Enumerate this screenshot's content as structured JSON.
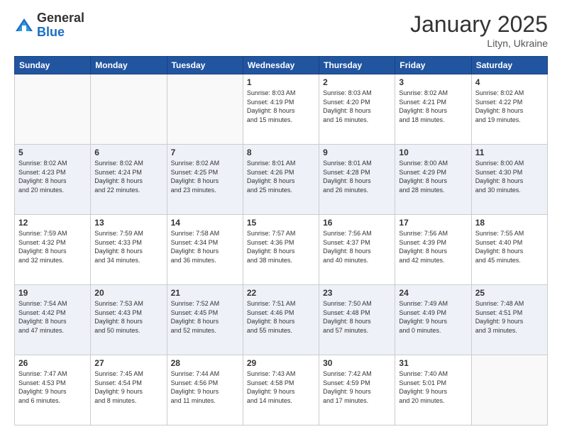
{
  "header": {
    "logo_general": "General",
    "logo_blue": "Blue",
    "month_title": "January 2025",
    "location": "Lityn, Ukraine"
  },
  "weekdays": [
    "Sunday",
    "Monday",
    "Tuesday",
    "Wednesday",
    "Thursday",
    "Friday",
    "Saturday"
  ],
  "weeks": [
    [
      {
        "day": "",
        "info": ""
      },
      {
        "day": "",
        "info": ""
      },
      {
        "day": "",
        "info": ""
      },
      {
        "day": "1",
        "info": "Sunrise: 8:03 AM\nSunset: 4:19 PM\nDaylight: 8 hours\nand 15 minutes."
      },
      {
        "day": "2",
        "info": "Sunrise: 8:03 AM\nSunset: 4:20 PM\nDaylight: 8 hours\nand 16 minutes."
      },
      {
        "day": "3",
        "info": "Sunrise: 8:02 AM\nSunset: 4:21 PM\nDaylight: 8 hours\nand 18 minutes."
      },
      {
        "day": "4",
        "info": "Sunrise: 8:02 AM\nSunset: 4:22 PM\nDaylight: 8 hours\nand 19 minutes."
      }
    ],
    [
      {
        "day": "5",
        "info": "Sunrise: 8:02 AM\nSunset: 4:23 PM\nDaylight: 8 hours\nand 20 minutes."
      },
      {
        "day": "6",
        "info": "Sunrise: 8:02 AM\nSunset: 4:24 PM\nDaylight: 8 hours\nand 22 minutes."
      },
      {
        "day": "7",
        "info": "Sunrise: 8:02 AM\nSunset: 4:25 PM\nDaylight: 8 hours\nand 23 minutes."
      },
      {
        "day": "8",
        "info": "Sunrise: 8:01 AM\nSunset: 4:26 PM\nDaylight: 8 hours\nand 25 minutes."
      },
      {
        "day": "9",
        "info": "Sunrise: 8:01 AM\nSunset: 4:28 PM\nDaylight: 8 hours\nand 26 minutes."
      },
      {
        "day": "10",
        "info": "Sunrise: 8:00 AM\nSunset: 4:29 PM\nDaylight: 8 hours\nand 28 minutes."
      },
      {
        "day": "11",
        "info": "Sunrise: 8:00 AM\nSunset: 4:30 PM\nDaylight: 8 hours\nand 30 minutes."
      }
    ],
    [
      {
        "day": "12",
        "info": "Sunrise: 7:59 AM\nSunset: 4:32 PM\nDaylight: 8 hours\nand 32 minutes."
      },
      {
        "day": "13",
        "info": "Sunrise: 7:59 AM\nSunset: 4:33 PM\nDaylight: 8 hours\nand 34 minutes."
      },
      {
        "day": "14",
        "info": "Sunrise: 7:58 AM\nSunset: 4:34 PM\nDaylight: 8 hours\nand 36 minutes."
      },
      {
        "day": "15",
        "info": "Sunrise: 7:57 AM\nSunset: 4:36 PM\nDaylight: 8 hours\nand 38 minutes."
      },
      {
        "day": "16",
        "info": "Sunrise: 7:56 AM\nSunset: 4:37 PM\nDaylight: 8 hours\nand 40 minutes."
      },
      {
        "day": "17",
        "info": "Sunrise: 7:56 AM\nSunset: 4:39 PM\nDaylight: 8 hours\nand 42 minutes."
      },
      {
        "day": "18",
        "info": "Sunrise: 7:55 AM\nSunset: 4:40 PM\nDaylight: 8 hours\nand 45 minutes."
      }
    ],
    [
      {
        "day": "19",
        "info": "Sunrise: 7:54 AM\nSunset: 4:42 PM\nDaylight: 8 hours\nand 47 minutes."
      },
      {
        "day": "20",
        "info": "Sunrise: 7:53 AM\nSunset: 4:43 PM\nDaylight: 8 hours\nand 50 minutes."
      },
      {
        "day": "21",
        "info": "Sunrise: 7:52 AM\nSunset: 4:45 PM\nDaylight: 8 hours\nand 52 minutes."
      },
      {
        "day": "22",
        "info": "Sunrise: 7:51 AM\nSunset: 4:46 PM\nDaylight: 8 hours\nand 55 minutes."
      },
      {
        "day": "23",
        "info": "Sunrise: 7:50 AM\nSunset: 4:48 PM\nDaylight: 8 hours\nand 57 minutes."
      },
      {
        "day": "24",
        "info": "Sunrise: 7:49 AM\nSunset: 4:49 PM\nDaylight: 9 hours\nand 0 minutes."
      },
      {
        "day": "25",
        "info": "Sunrise: 7:48 AM\nSunset: 4:51 PM\nDaylight: 9 hours\nand 3 minutes."
      }
    ],
    [
      {
        "day": "26",
        "info": "Sunrise: 7:47 AM\nSunset: 4:53 PM\nDaylight: 9 hours\nand 6 minutes."
      },
      {
        "day": "27",
        "info": "Sunrise: 7:45 AM\nSunset: 4:54 PM\nDaylight: 9 hours\nand 8 minutes."
      },
      {
        "day": "28",
        "info": "Sunrise: 7:44 AM\nSunset: 4:56 PM\nDaylight: 9 hours\nand 11 minutes."
      },
      {
        "day": "29",
        "info": "Sunrise: 7:43 AM\nSunset: 4:58 PM\nDaylight: 9 hours\nand 14 minutes."
      },
      {
        "day": "30",
        "info": "Sunrise: 7:42 AM\nSunset: 4:59 PM\nDaylight: 9 hours\nand 17 minutes."
      },
      {
        "day": "31",
        "info": "Sunrise: 7:40 AM\nSunset: 5:01 PM\nDaylight: 9 hours\nand 20 minutes."
      },
      {
        "day": "",
        "info": ""
      }
    ]
  ]
}
